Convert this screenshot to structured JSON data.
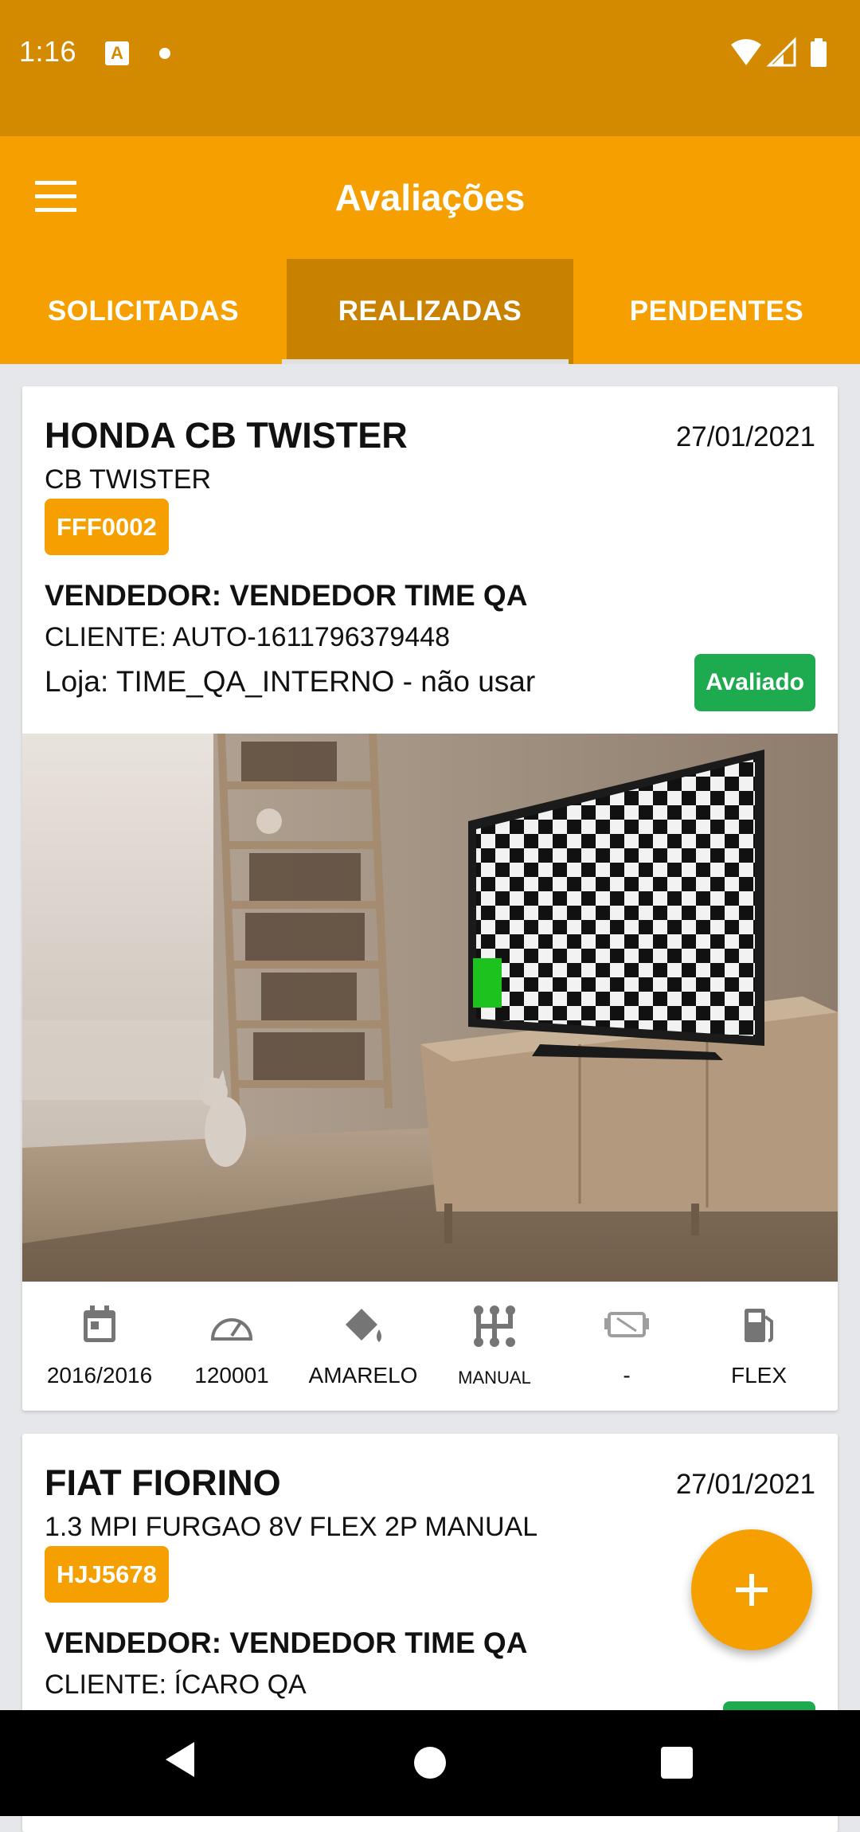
{
  "status_bar": {
    "time": "1:16",
    "notification_icon": "A"
  },
  "app_bar": {
    "title": "Avaliações"
  },
  "tabs": [
    {
      "label": "SOLICITADAS",
      "active": false
    },
    {
      "label": "REALIZADAS",
      "active": true
    },
    {
      "label": "PENDENTES",
      "active": false
    }
  ],
  "cards": [
    {
      "title": "HONDA CB TWISTER",
      "date": "27/01/2021",
      "model": "CB TWISTER",
      "plate": "FFF0002",
      "seller": "VENDEDOR: VENDEDOR TIME QA",
      "client": "CLIENTE: AUTO-1611796379448",
      "store": "Loja: TIME_QA_INTERNO - não usar",
      "status": "Avaliado",
      "specs": [
        {
          "icon": "calendar-icon",
          "value": "2016/2016"
        },
        {
          "icon": "speedometer-icon",
          "value": "120001"
        },
        {
          "icon": "paint-bucket-icon",
          "value": "AMARELO"
        },
        {
          "icon": "gearshift-icon",
          "value": "MANUAL"
        },
        {
          "icon": "car-side-icon",
          "value": "-"
        },
        {
          "icon": "fuel-pump-icon",
          "value": "FLEX"
        }
      ]
    },
    {
      "title": "FIAT FIORINO",
      "date": "27/01/2021",
      "model": "1.3 MPI FURGAO 8V FLEX 2P MANUAL",
      "plate": "HJJ5678",
      "seller": "VENDEDOR: VENDEDOR TIME QA",
      "client": "CLIENTE: ÍCARO QA"
    }
  ],
  "colors": {
    "accent": "#f5a000",
    "status_bar": "#d48a00",
    "tab_active": "#c88200",
    "badge_green": "#1eab4f"
  }
}
